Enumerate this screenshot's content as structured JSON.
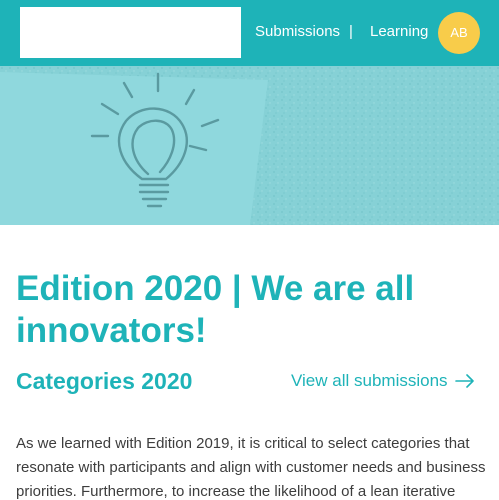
{
  "nav": {
    "submissions": "Submissions",
    "separator": "|",
    "learning": "Learning",
    "avatar_initials": "AB"
  },
  "hero": {
    "icon": "lightbulb-icon"
  },
  "content": {
    "title": "Edition 2020 | We are all innovators!",
    "section_title": "Categories 2020",
    "view_all_link": "View all submissions",
    "arrow_icon": "arrow-right-icon",
    "paragraph": "As we learned with Edition 2019, it is critical to select categories that resonate with participants and align with customer needs and business priorities. Furthermore, to increase the likelihood of a lean iterative"
  },
  "colors": {
    "primary": "#1eb3b8",
    "avatar": "#f8cc4a",
    "hero_background": "#86d1d6",
    "text": "#3d3d3d"
  }
}
